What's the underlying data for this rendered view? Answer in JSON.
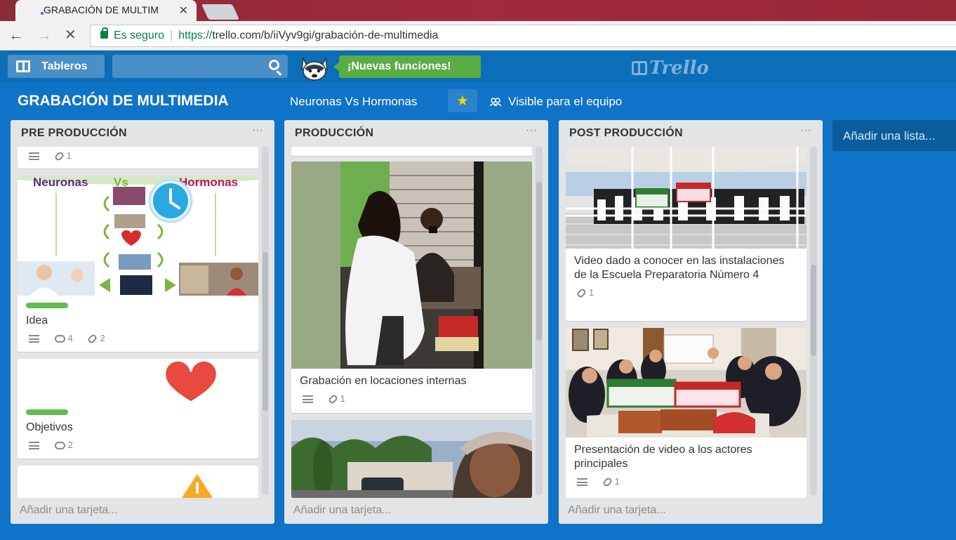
{
  "browser": {
    "tab_title": "GRABACIÓN DE MULTIM",
    "tab_close": "✕",
    "back": "←",
    "forward": "→",
    "stop": "✕",
    "secure_label": "Es seguro",
    "url_scheme": "https://",
    "url_rest": "trello.com/b/iiVyv9gi/grabación-de-multimedia"
  },
  "header": {
    "boards_label": "Tableros",
    "new_features": "¡Nuevas funciones!",
    "logo_text": "Trello"
  },
  "board": {
    "title": "GRABACIÓN DE MULTIMEDIA",
    "team": "Neuronas Vs Hormonas",
    "star": "★",
    "visibility": "Visible para el equipo"
  },
  "lists": [
    {
      "title": "PRE PRODUCCIÓN",
      "menu": "···",
      "add_card": "Añadir una tarjeta...",
      "cards": [
        {
          "attachments": "1"
        },
        {
          "image_heading_left": "Neuronas",
          "image_heading_vs": "Vs",
          "image_heading_right": "Hormonas",
          "title": "Idea",
          "comments": "4",
          "attachments": "2"
        },
        {
          "title": "Objetivos",
          "comments": "2"
        }
      ]
    },
    {
      "title": "PRODUCCIÓN",
      "menu": "···",
      "add_card": "Añadir una tarjeta...",
      "cards": [
        {
          "title": "Grabación en locaciones internas",
          "attachments": "1"
        }
      ]
    },
    {
      "title": "POST PRODUCCIÓN",
      "menu": "···",
      "add_card": "Añadir una tarjeta...",
      "cards": [
        {
          "title": "Video dado a conocer en las instalaciones de la Escuela Preparatoria Número 4",
          "attachments": "1"
        },
        {
          "title": "Presentación de video a los actores principales",
          "attachments": "1"
        }
      ]
    }
  ],
  "add_list": "Añadir una lista...",
  "colors": {
    "board_bg": "#0f73c8",
    "header_bg": "#0c6eb8",
    "label_green": "#61bd4f",
    "new_features_green": "#5aac44"
  }
}
